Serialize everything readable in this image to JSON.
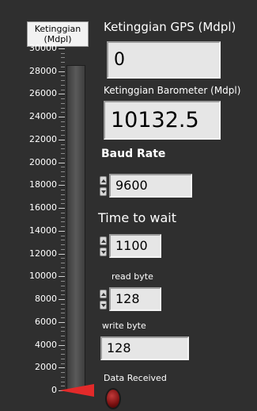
{
  "altitude_gauge": {
    "title_line1": "Ketinggian",
    "title_line2": "(Mdpl)",
    "scale_labels": [
      "30000",
      "28000",
      "26000",
      "24000",
      "22000",
      "20000",
      "18000",
      "16000",
      "14000",
      "12000",
      "10000",
      "8000",
      "6000",
      "4000",
      "2000",
      "0"
    ],
    "value": 0,
    "pointer_color": "#e32a2a"
  },
  "gps": {
    "label": "Ketinggian GPS (Mdpl)",
    "value": "0"
  },
  "barometer": {
    "label": "Ketinggian Barometer (Mdpl)",
    "value": "10132.5"
  },
  "baud_rate": {
    "label": "Baud Rate",
    "value": "9600"
  },
  "time_to_wait": {
    "label": "Time to wait",
    "value": "1100"
  },
  "read_byte": {
    "label": "read byte",
    "value": "128"
  },
  "write_byte": {
    "label": "write byte",
    "value": "128"
  },
  "data_received": {
    "label": "Data Received",
    "led_color": "#7a1010"
  },
  "icons": {
    "spinner_up": "triangle-up-icon",
    "spinner_down": "triangle-down-icon"
  }
}
